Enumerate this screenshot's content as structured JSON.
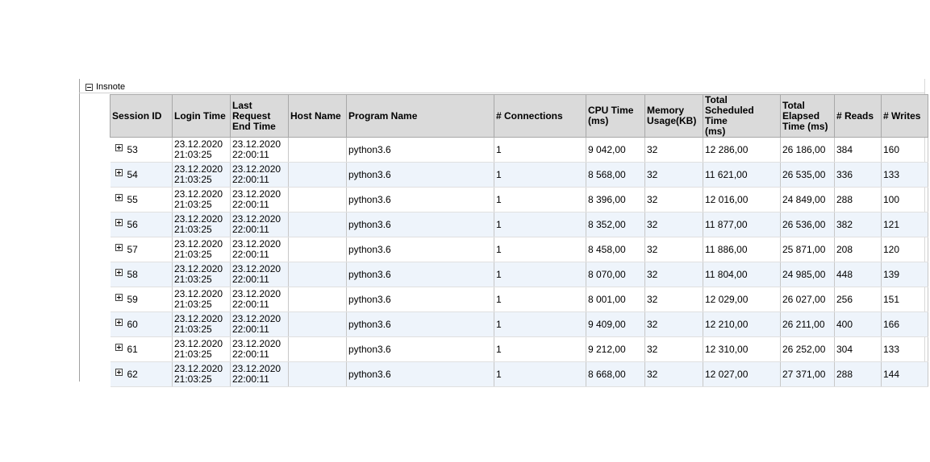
{
  "group": {
    "label": "Insnote",
    "expanded": true
  },
  "columns": [
    "Session ID",
    "Login Time",
    "Last Request End Time",
    "Host Name",
    "Program Name",
    "# Connections",
    "CPU Time (ms)",
    "Memory Usage(KB)",
    "Total Scheduled Time (ms)",
    "Total Elapsed Time (ms)",
    "# Reads",
    "# Writes"
  ],
  "header_lines": {
    "c0": [
      "Session ID"
    ],
    "c1": [
      "Login Time"
    ],
    "c2": [
      "Last",
      "Request",
      "End Time"
    ],
    "c3": [
      "Host Name"
    ],
    "c4": [
      "Program Name"
    ],
    "c5": [
      "# Connections"
    ],
    "c6": [
      "CPU Time",
      "(ms)"
    ],
    "c7": [
      "Memory",
      "Usage(KB)"
    ],
    "c8": [
      "Total",
      "Scheduled Time",
      "(ms)"
    ],
    "c9": [
      "Total",
      "Elapsed",
      "Time (ms)"
    ],
    "c10": [
      "# Reads"
    ],
    "c11": [
      "# Writes"
    ]
  },
  "rows": [
    {
      "session_id": "53",
      "login_date": "23.12.2020",
      "login_time": "21:03:25",
      "last_date": "23.12.2020",
      "last_time": "22:00:11",
      "host": "",
      "program": "python3.6",
      "connections": "1",
      "cpu": "9 042,00",
      "memory": "32",
      "scheduled": "12 286,00",
      "elapsed": "26 186,00",
      "reads": "384",
      "writes": "160"
    },
    {
      "session_id": "54",
      "login_date": "23.12.2020",
      "login_time": "21:03:25",
      "last_date": "23.12.2020",
      "last_time": "22:00:11",
      "host": "",
      "program": "python3.6",
      "connections": "1",
      "cpu": "8 568,00",
      "memory": "32",
      "scheduled": "11 621,00",
      "elapsed": "26 535,00",
      "reads": "336",
      "writes": "133"
    },
    {
      "session_id": "55",
      "login_date": "23.12.2020",
      "login_time": "21:03:25",
      "last_date": "23.12.2020",
      "last_time": "22:00:11",
      "host": "",
      "program": "python3.6",
      "connections": "1",
      "cpu": "8 396,00",
      "memory": "32",
      "scheduled": "12 016,00",
      "elapsed": "24 849,00",
      "reads": "288",
      "writes": "100"
    },
    {
      "session_id": "56",
      "login_date": "23.12.2020",
      "login_time": "21:03:25",
      "last_date": "23.12.2020",
      "last_time": "22:00:11",
      "host": "",
      "program": "python3.6",
      "connections": "1",
      "cpu": "8 352,00",
      "memory": "32",
      "scheduled": "11 877,00",
      "elapsed": "26 536,00",
      "reads": "382",
      "writes": "121"
    },
    {
      "session_id": "57",
      "login_date": "23.12.2020",
      "login_time": "21:03:25",
      "last_date": "23.12.2020",
      "last_time": "22:00:11",
      "host": "",
      "program": "python3.6",
      "connections": "1",
      "cpu": "8 458,00",
      "memory": "32",
      "scheduled": "11 886,00",
      "elapsed": "25 871,00",
      "reads": "208",
      "writes": "120"
    },
    {
      "session_id": "58",
      "login_date": "23.12.2020",
      "login_time": "21:03:25",
      "last_date": "23.12.2020",
      "last_time": "22:00:11",
      "host": "",
      "program": "python3.6",
      "connections": "1",
      "cpu": "8 070,00",
      "memory": "32",
      "scheduled": "11 804,00",
      "elapsed": "24 985,00",
      "reads": "448",
      "writes": "139"
    },
    {
      "session_id": "59",
      "login_date": "23.12.2020",
      "login_time": "21:03:25",
      "last_date": "23.12.2020",
      "last_time": "22:00:11",
      "host": "",
      "program": "python3.6",
      "connections": "1",
      "cpu": "8 001,00",
      "memory": "32",
      "scheduled": "12 029,00",
      "elapsed": "26 027,00",
      "reads": "256",
      "writes": "151"
    },
    {
      "session_id": "60",
      "login_date": "23.12.2020",
      "login_time": "21:03:25",
      "last_date": "23.12.2020",
      "last_time": "22:00:11",
      "host": "",
      "program": "python3.6",
      "connections": "1",
      "cpu": "9 409,00",
      "memory": "32",
      "scheduled": "12 210,00",
      "elapsed": "26 211,00",
      "reads": "400",
      "writes": "166"
    },
    {
      "session_id": "61",
      "login_date": "23.12.2020",
      "login_time": "21:03:25",
      "last_date": "23.12.2020",
      "last_time": "22:00:11",
      "host": "",
      "program": "python3.6",
      "connections": "1",
      "cpu": "9 212,00",
      "memory": "32",
      "scheduled": "12 310,00",
      "elapsed": "26 252,00",
      "reads": "304",
      "writes": "133"
    },
    {
      "session_id": "62",
      "login_date": "23.12.2020",
      "login_time": "21:03:25",
      "last_date": "23.12.2020",
      "last_time": "22:00:11",
      "host": "",
      "program": "python3.6",
      "connections": "1",
      "cpu": "8 668,00",
      "memory": "32",
      "scheduled": "12 027,00",
      "elapsed": "27 371,00",
      "reads": "288",
      "writes": "144"
    }
  ]
}
